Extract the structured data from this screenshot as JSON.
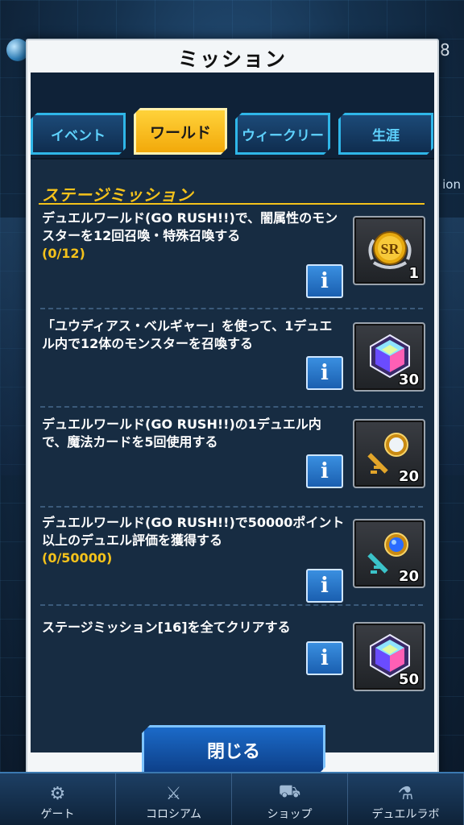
{
  "header": {
    "title": "ミッション",
    "side_number": "8",
    "side_text": "ion"
  },
  "tabs": [
    {
      "label": "イベント",
      "active": false
    },
    {
      "label": "ワールド",
      "active": true
    },
    {
      "label": "ウィークリー",
      "active": false
    },
    {
      "label": "生涯",
      "active": false
    }
  ],
  "section": {
    "title": "ステージミッション"
  },
  "missions": [
    {
      "text": "デュエルワールド(GO RUSH!!)で、闇属性のモンスターを12回召喚・特殊召喚する",
      "progress": "(0/12)",
      "info_label": "i",
      "reward": {
        "icon": "sr-medal-icon",
        "count": "1"
      }
    },
    {
      "text": "「ユウディアス・ベルギャー」を使って、1デュエル内で12体のモンスターを召喚する",
      "progress": "",
      "info_label": "i",
      "reward": {
        "icon": "gem-icon",
        "count": "30"
      }
    },
    {
      "text": "デュエルワールド(GO RUSH!!)の1デュエル内で、魔法カードを5回使用する",
      "progress": "",
      "info_label": "i",
      "reward": {
        "icon": "white-key-icon",
        "count": "20"
      }
    },
    {
      "text": "デュエルワールド(GO RUSH!!)で50000ポイント以上のデュエル評価を獲得する",
      "progress": "(0/50000)",
      "info_label": "i",
      "reward": {
        "icon": "blue-key-icon",
        "count": "20"
      }
    },
    {
      "text": "ステージミッション[16]を全てクリアする",
      "progress": "",
      "info_label": "i",
      "reward": {
        "icon": "gem-icon",
        "count": "50"
      }
    }
  ],
  "close_button": {
    "label": "閉じる"
  },
  "bottom_nav": [
    {
      "label": "ゲート",
      "icon": "gate-icon"
    },
    {
      "label": "コロシアム",
      "icon": "swords-icon"
    },
    {
      "label": "ショップ",
      "icon": "cart-icon"
    },
    {
      "label": "デュエルラボ",
      "icon": "lab-icon"
    }
  ],
  "colors": {
    "accent_gold": "#f4c21b",
    "tab_cyan": "#2fb6e8",
    "panel_bg": "#172c42",
    "button_blue": "#1b6ac8"
  }
}
